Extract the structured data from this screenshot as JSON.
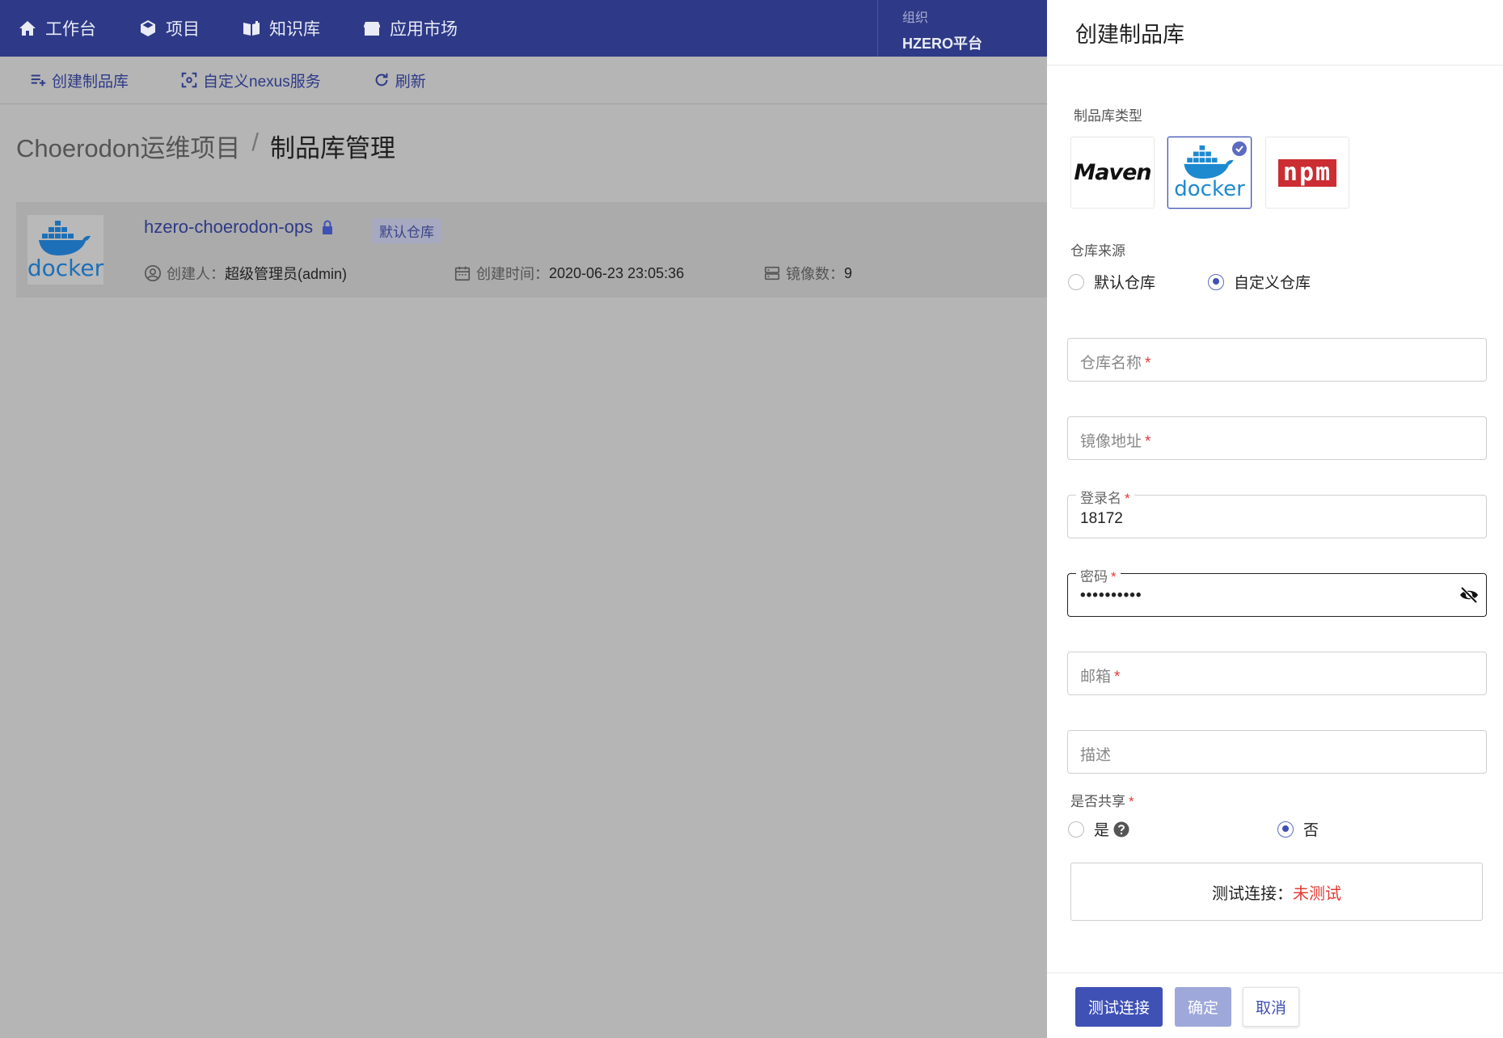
{
  "nav": {
    "items": [
      {
        "label": "工作台",
        "icon": "home-icon"
      },
      {
        "label": "项目",
        "icon": "cube-icon"
      },
      {
        "label": "知识库",
        "icon": "book-icon"
      },
      {
        "label": "应用市场",
        "icon": "store-icon"
      }
    ],
    "org_label": "组织",
    "org_value": "HZERO平台"
  },
  "toolbar": {
    "create_label": "创建制品库",
    "nexus_label": "自定义nexus服务",
    "refresh_label": "刷新"
  },
  "breadcrumb": {
    "project": "Choerodon运维项目",
    "separator": "/",
    "current": "制品库管理"
  },
  "repo": {
    "logo_text": "docker",
    "name": "hzero-choerodon-ops",
    "tag": "默认仓库",
    "creator_label": "创建人：",
    "creator_value": "超级管理员(admin)",
    "created_label": "创建时间：",
    "created_value": "2020-06-23 23:05:36",
    "images_label": "镜像数：",
    "images_value": "9"
  },
  "drawer": {
    "title": "创建制品库",
    "type_label": "制品库类型",
    "types": [
      {
        "label": "Maven",
        "selected": false
      },
      {
        "label": "docker",
        "selected": true
      },
      {
        "label": "npm",
        "selected": false
      }
    ],
    "source_label": "仓库来源",
    "source_options": [
      "默认仓库",
      "自定义仓库"
    ],
    "source_selected": "自定义仓库",
    "fields": {
      "repo_name": {
        "label": "仓库名称",
        "required": "*",
        "value": ""
      },
      "image_addr": {
        "label": "镜像地址",
        "required": "*",
        "value": ""
      },
      "login": {
        "label": "登录名",
        "required": "*",
        "value": "18172"
      },
      "password": {
        "label": "密码",
        "required": "*",
        "value": "••••••••••"
      },
      "email": {
        "label": "邮箱",
        "required": "*",
        "value": ""
      },
      "desc": {
        "label": "描述",
        "value": ""
      }
    },
    "share_label": "是否共享",
    "share_required": "*",
    "share_options": [
      "是",
      "否"
    ],
    "share_selected": "否",
    "test_label": "测试连接：",
    "test_status": "未测试",
    "buttons": {
      "test": "测试连接",
      "ok": "确定",
      "cancel": "取消"
    }
  },
  "colors": {
    "primary": "#3f51b5",
    "nav_bg": "#2e3a87",
    "required": "#e53935"
  }
}
